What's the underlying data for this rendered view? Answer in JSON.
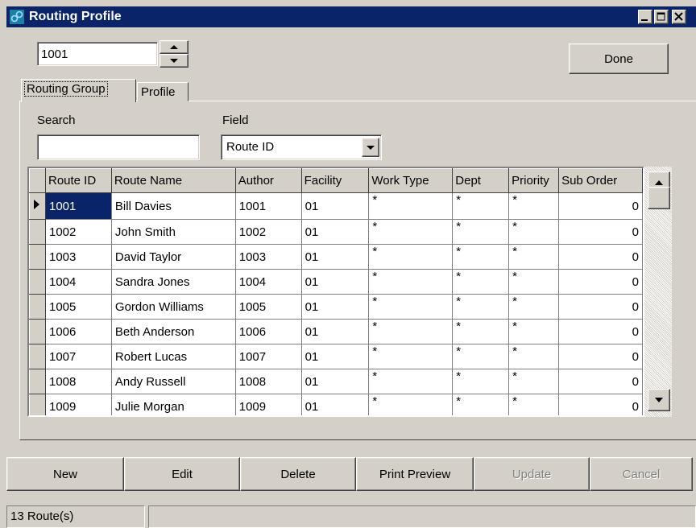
{
  "window": {
    "title": "Routing Profile"
  },
  "header": {
    "spinner_value": "1001",
    "done_label": "Done"
  },
  "tabs": [
    {
      "label": "Routing Group",
      "active": true
    },
    {
      "label": "Profile",
      "active": false
    }
  ],
  "search": {
    "search_label": "Search",
    "search_value": "",
    "field_label": "Field",
    "field_value": "Route ID"
  },
  "grid": {
    "columns": [
      "Route ID",
      "Route Name",
      "Author",
      "Facility",
      "Work Type",
      "Dept",
      "Priority",
      "Sub Order"
    ],
    "rows": [
      [
        "1001",
        "Bill Davies",
        "1001",
        "01",
        "*",
        "*",
        "*",
        "0"
      ],
      [
        "1002",
        "John Smith",
        "1002",
        "01",
        "*",
        "*",
        "*",
        "0"
      ],
      [
        "1003",
        "David Taylor",
        "1003",
        "01",
        "*",
        "*",
        "*",
        "0"
      ],
      [
        "1004",
        "Sandra Jones",
        "1004",
        "01",
        "*",
        "*",
        "*",
        "0"
      ],
      [
        "1005",
        "Gordon Williams",
        "1005",
        "01",
        "*",
        "*",
        "*",
        "0"
      ],
      [
        "1006",
        "Beth Anderson",
        "1006",
        "01",
        "*",
        "*",
        "*",
        "0"
      ],
      [
        "1007",
        "Robert Lucas",
        "1007",
        "01",
        "*",
        "*",
        "*",
        "0"
      ],
      [
        "1008",
        "Andy Russell",
        "1008",
        "01",
        "*",
        "*",
        "*",
        "0"
      ],
      [
        "1009",
        "Julie Morgan",
        "1009",
        "01",
        "*",
        "*",
        "*",
        "0"
      ]
    ]
  },
  "actions": {
    "new": "New",
    "edit": "Edit",
    "delete": "Delete",
    "print_preview": "Print Preview",
    "update": "Update",
    "cancel": "Cancel"
  },
  "status": {
    "count_text": "13 Route(s)"
  },
  "colors": {
    "title_bar": "#0a246a",
    "face": "#d4d0c8",
    "selection": "#0a246a"
  }
}
